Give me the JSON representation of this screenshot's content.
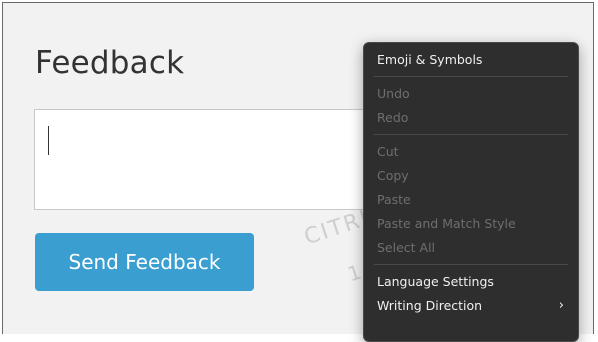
{
  "page": {
    "title": "Feedback",
    "send_button_label": "Send Feedback",
    "watermark_line1": "CITRIX",
    "watermark_line2": "1"
  },
  "context_menu": {
    "emoji": "Emoji & Symbols",
    "undo": "Undo",
    "redo": "Redo",
    "cut": "Cut",
    "copy": "Copy",
    "paste": "Paste",
    "paste_match": "Paste and Match Style",
    "select_all": "Select All",
    "language_settings": "Language Settings",
    "writing_direction": "Writing Direction",
    "submenu_glyph": "›"
  },
  "colors": {
    "accent": "#3a9fd0",
    "menu_bg": "#2e2e2e",
    "menu_disabled": "#6e6e6e"
  }
}
